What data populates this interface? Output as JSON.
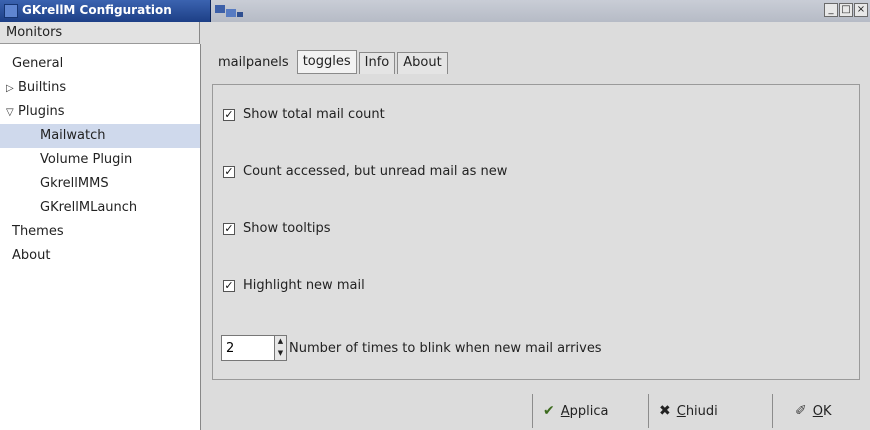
{
  "window": {
    "title": "GKrellM Configuration",
    "buttons": [
      "_",
      "□",
      "×"
    ]
  },
  "sidebar": {
    "header": "Monitors",
    "items": [
      {
        "label": "General",
        "indent": 1
      },
      {
        "label": "Builtins",
        "indent": 0,
        "arrow": "▷"
      },
      {
        "label": "Plugins",
        "indent": 0,
        "arrow": "▽"
      },
      {
        "label": "Mailwatch",
        "indent": 2,
        "selected": true
      },
      {
        "label": "Volume Plugin",
        "indent": 2
      },
      {
        "label": "GkrellMMS",
        "indent": 2
      },
      {
        "label": "GKrellMLaunch",
        "indent": 2
      },
      {
        "label": "Themes",
        "indent": 1
      },
      {
        "label": "About",
        "indent": 1
      }
    ]
  },
  "tabs": [
    {
      "label": "mailpanels",
      "style": "plain"
    },
    {
      "label": "toggles",
      "style": "active"
    },
    {
      "label": "Info",
      "style": "normal"
    },
    {
      "label": "About",
      "style": "normal"
    }
  ],
  "options": [
    {
      "label": "Show total mail count",
      "checked": true
    },
    {
      "label": "Count accessed, but unread mail as new",
      "checked": true
    },
    {
      "label": "Show tooltips",
      "checked": true
    },
    {
      "label": "Highlight new mail",
      "checked": true
    }
  ],
  "blink": {
    "value": "2",
    "label": "Number of times to blink when new mail arrives"
  },
  "buttons": {
    "apply": {
      "mnemonic": "A",
      "rest": "pplica",
      "icon": "✔"
    },
    "close": {
      "mnemonic": "C",
      "rest": "hiudi",
      "icon": "✖"
    },
    "ok": {
      "mnemonic": "O",
      "rest": "K",
      "icon": "✐"
    }
  },
  "colors": {
    "title_active": "#1d3f86",
    "selection": "#cfd9ec"
  }
}
